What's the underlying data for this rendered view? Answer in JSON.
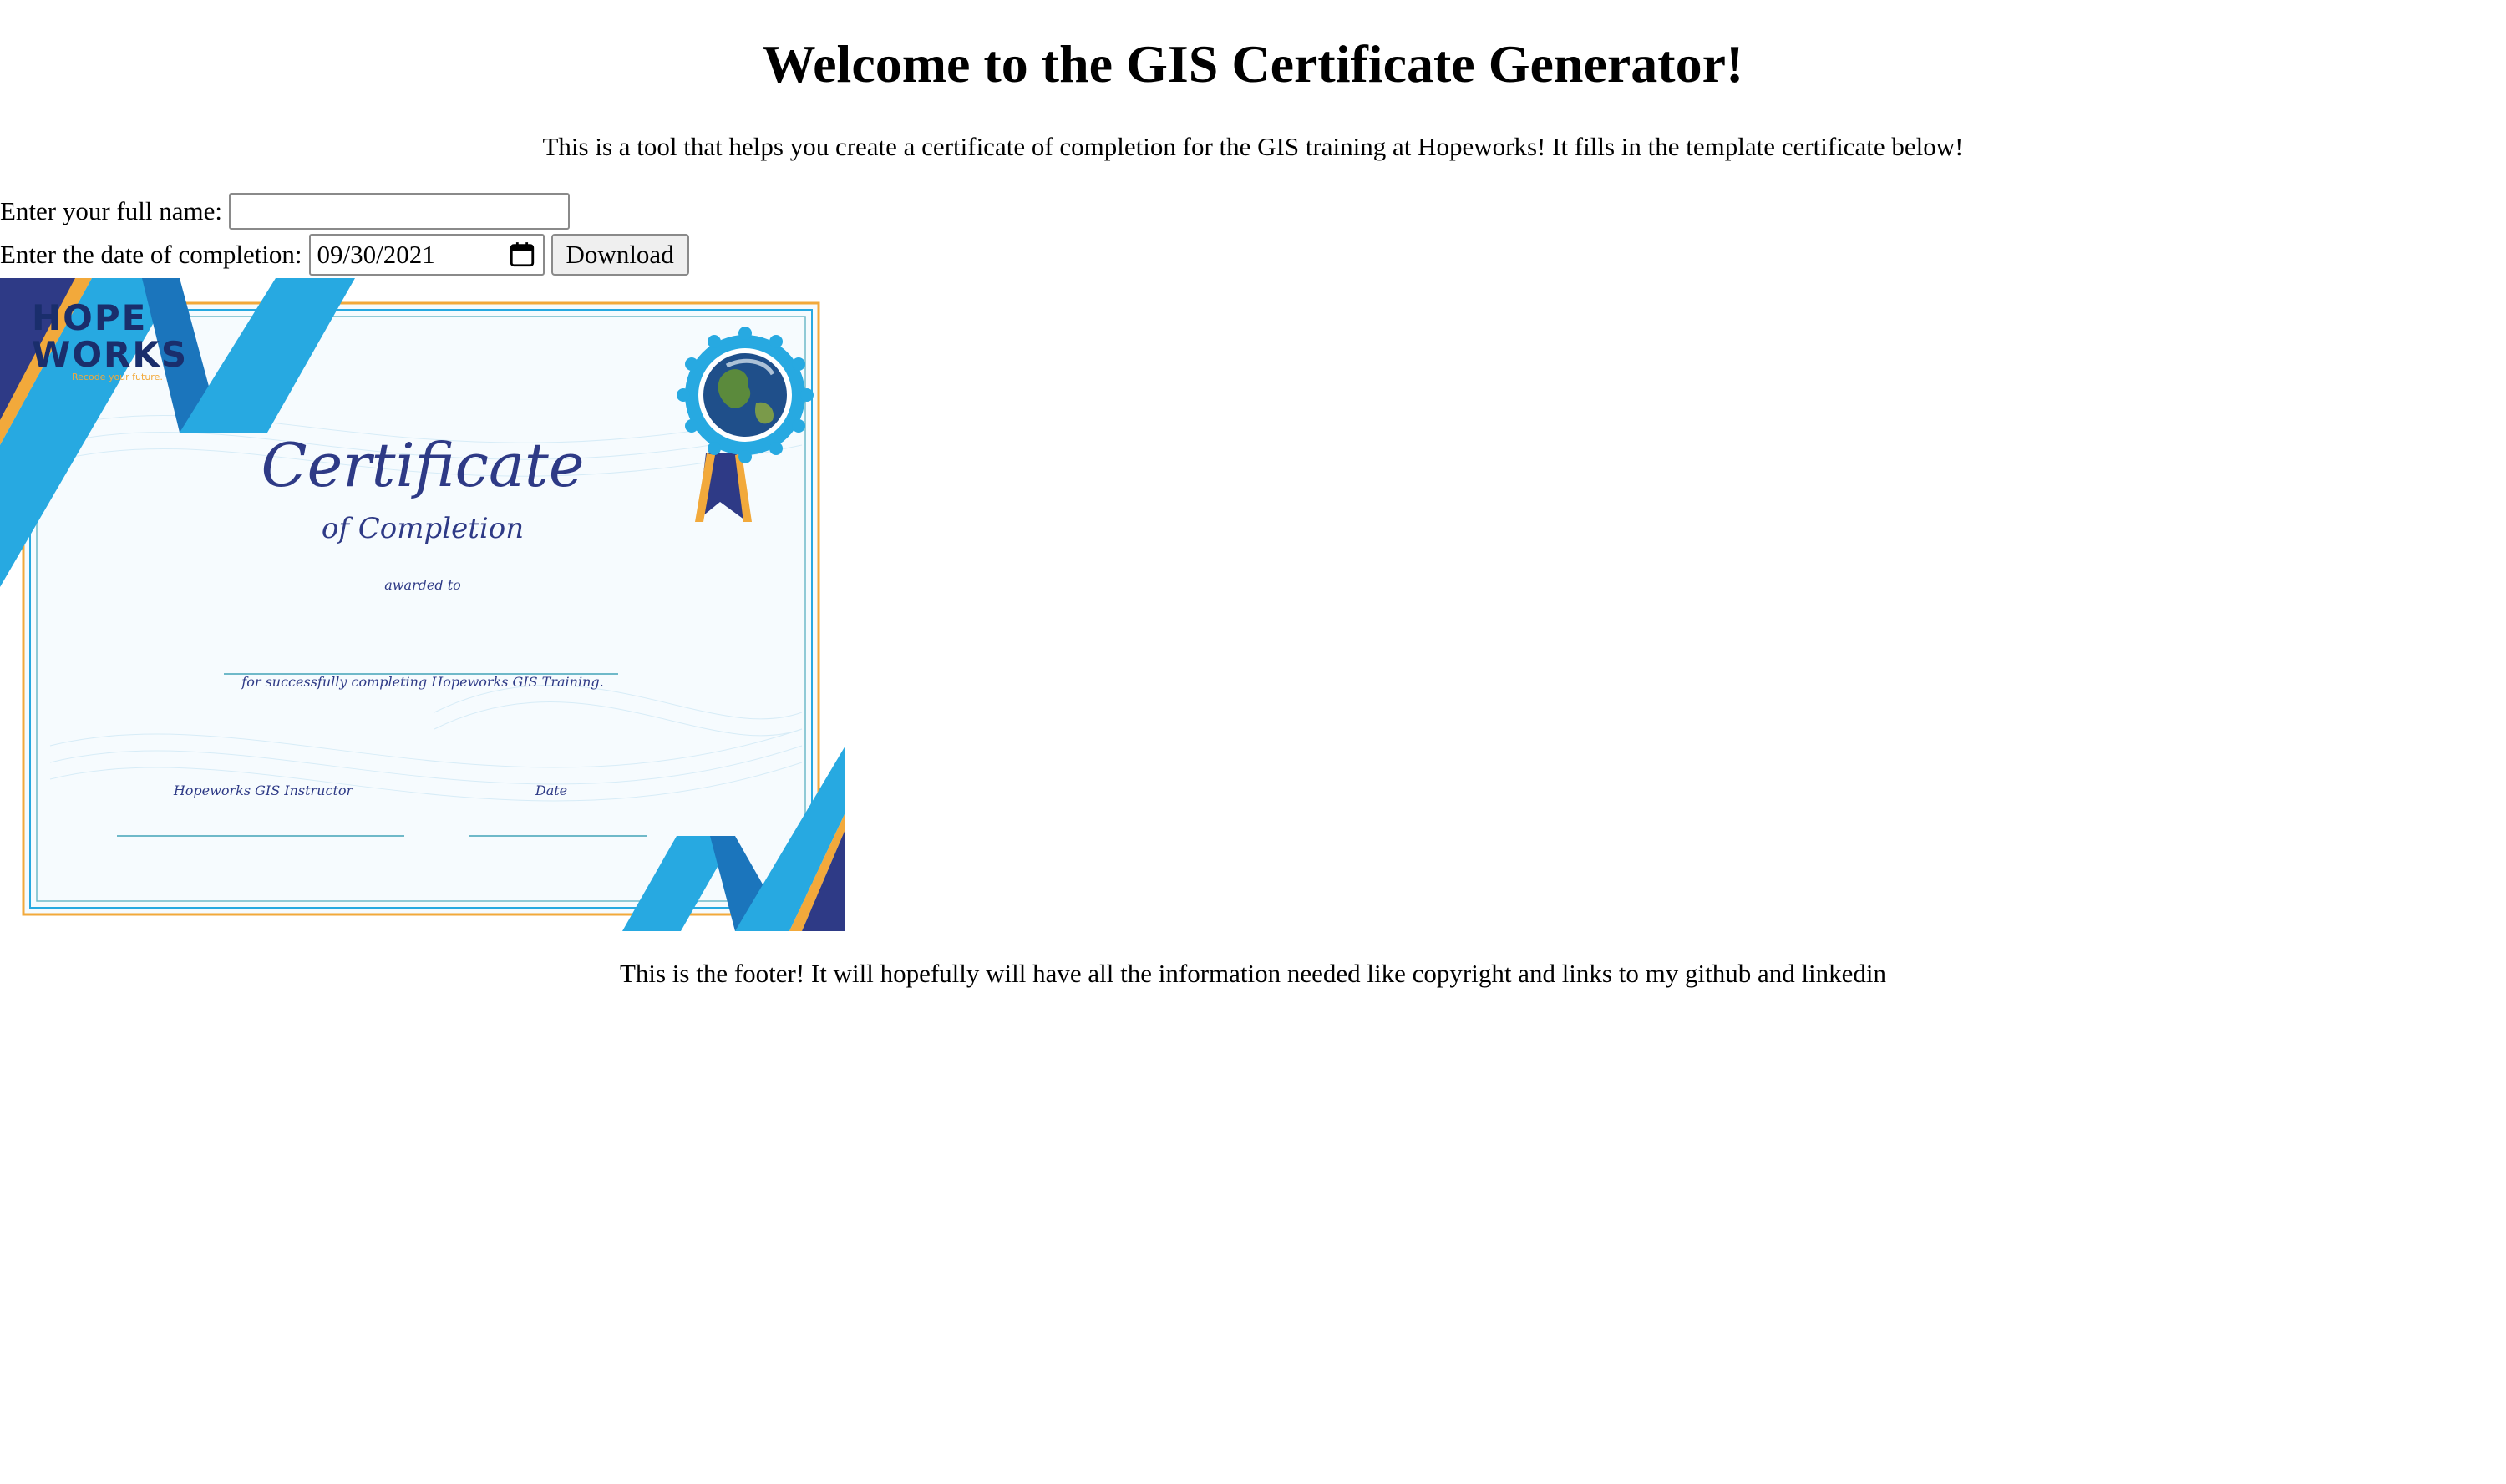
{
  "header": {
    "title": "Welcome to the GIS Certificate Generator!",
    "intro": "This is a tool that helps you create a certificate of completion for the GIS training at Hopeworks! It fills in the template certificate below!"
  },
  "form": {
    "name_label": "Enter your full name:",
    "name_value": "",
    "name_placeholder": "",
    "date_label": "Enter the date of completion:",
    "date_value": "09/30/2021",
    "download_label": "Download"
  },
  "certificate": {
    "logo_line1": "HOPE",
    "logo_line2": "WORKS",
    "logo_tagline": "Recode your future.",
    "title": "Certificate",
    "subtitle": "of Completion",
    "awarded_to": "awarded to",
    "completion_text": "for successfully completing Hopeworks GIS Training.",
    "instructor_label": "Hopeworks GIS Instructor",
    "date_label": "Date",
    "colors": {
      "navy": "#2e3a86",
      "blue": "#27a9e1",
      "mid_blue": "#1b75bc",
      "gold": "#f2a93b"
    }
  },
  "footer": {
    "text": "This is the footer! It will hopefully will have all the information needed like copyright and links to my github and linkedin"
  }
}
